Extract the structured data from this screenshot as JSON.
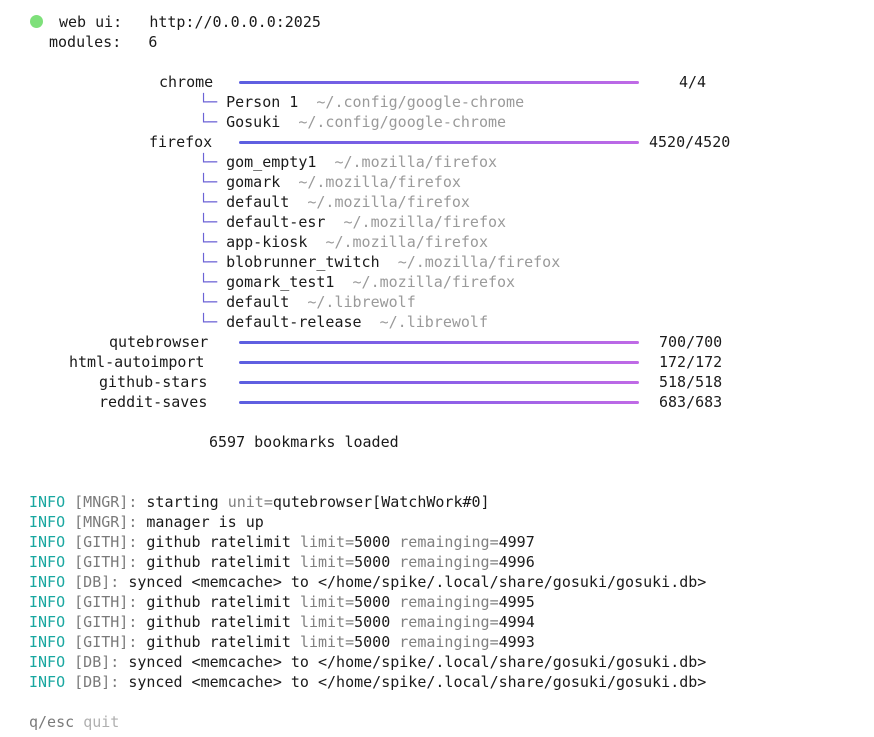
{
  "header": {
    "webui_label": "web ui:",
    "webui_url": "http://0.0.0.0:2025",
    "modules_label": "modules:",
    "modules_count": "6"
  },
  "modules": {
    "chrome": {
      "name": "chrome",
      "progress": 1.0,
      "count": "4/4",
      "profiles": [
        {
          "name": "Person 1",
          "path": "~/.config/google-chrome"
        },
        {
          "name": "Gosuki",
          "path": "~/.config/google-chrome"
        }
      ]
    },
    "firefox": {
      "name": "firefox",
      "progress": 1.0,
      "count": "4520/4520",
      "profiles": [
        {
          "name": "gom_empty1",
          "path": "~/.mozilla/firefox"
        },
        {
          "name": "gomark",
          "path": "~/.mozilla/firefox"
        },
        {
          "name": "default",
          "path": "~/.mozilla/firefox"
        },
        {
          "name": "default-esr",
          "path": "~/.mozilla/firefox"
        },
        {
          "name": "app-kiosk",
          "path": "~/.mozilla/firefox"
        },
        {
          "name": "blobrunner_twitch",
          "path": "~/.mozilla/firefox"
        },
        {
          "name": "gomark_test1",
          "path": "~/.mozilla/firefox"
        },
        {
          "name": "default",
          "path": "~/.librewolf"
        },
        {
          "name": "default-release",
          "path": "~/.librewolf"
        }
      ]
    },
    "qutebrowser": {
      "name": "qutebrowser",
      "progress": 1.0,
      "count": "700/700"
    },
    "html_autoimport": {
      "name": "html-autoimport",
      "progress": 1.0,
      "count": "172/172"
    },
    "github_stars": {
      "name": "github-stars",
      "progress": 1.0,
      "count": "518/518"
    },
    "reddit_saves": {
      "name": "reddit-saves",
      "progress": 1.0,
      "count": "683/683"
    }
  },
  "summary": "6597 bookmarks loaded",
  "logs": [
    {
      "level": "INFO",
      "tag": "[MNGR]:",
      "message": "starting",
      "kv": [
        {
          "k": "unit",
          "v": "qutebrowser[WatchWork#0]"
        }
      ]
    },
    {
      "level": "INFO",
      "tag": "[MNGR]:",
      "message": "manager is up",
      "kv": []
    },
    {
      "level": "INFO",
      "tag": "[GITH]:",
      "message": "github ratelimit",
      "kv": [
        {
          "k": "limit",
          "v": "5000"
        },
        {
          "k": "remainging",
          "v": "4997"
        }
      ]
    },
    {
      "level": "INFO",
      "tag": "[GITH]:",
      "message": "github ratelimit",
      "kv": [
        {
          "k": "limit",
          "v": "5000"
        },
        {
          "k": "remainging",
          "v": "4996"
        }
      ]
    },
    {
      "level": "INFO",
      "tag": "[DB]:",
      "message": "synced <memcache> to </home/spike/.local/share/gosuki/gosuki.db>",
      "kv": []
    },
    {
      "level": "INFO",
      "tag": "[GITH]:",
      "message": "github ratelimit",
      "kv": [
        {
          "k": "limit",
          "v": "5000"
        },
        {
          "k": "remainging",
          "v": "4995"
        }
      ]
    },
    {
      "level": "INFO",
      "tag": "[GITH]:",
      "message": "github ratelimit",
      "kv": [
        {
          "k": "limit",
          "v": "5000"
        },
        {
          "k": "remainging",
          "v": "4994"
        }
      ]
    },
    {
      "level": "INFO",
      "tag": "[GITH]:",
      "message": "github ratelimit",
      "kv": [
        {
          "k": "limit",
          "v": "5000"
        },
        {
          "k": "remainging",
          "v": "4993"
        }
      ]
    },
    {
      "level": "INFO",
      "tag": "[DB]:",
      "message": "synced <memcache> to </home/spike/.local/share/gosuki/gosuki.db>",
      "kv": []
    },
    {
      "level": "INFO",
      "tag": "[DB]:",
      "message": "synced <memcache> to </home/spike/.local/share/gosuki/gosuki.db>",
      "kv": []
    }
  ],
  "footer": {
    "keys": "q/esc",
    "action": "quit"
  },
  "colors": {
    "status_dot": "#7ee07a",
    "info": "#19a7a0",
    "bar_start": "#5b5fe0",
    "bar_end": "#c06ae6"
  },
  "icons": {
    "status": "status-dot-icon",
    "tree": "tree-branch-icon"
  }
}
